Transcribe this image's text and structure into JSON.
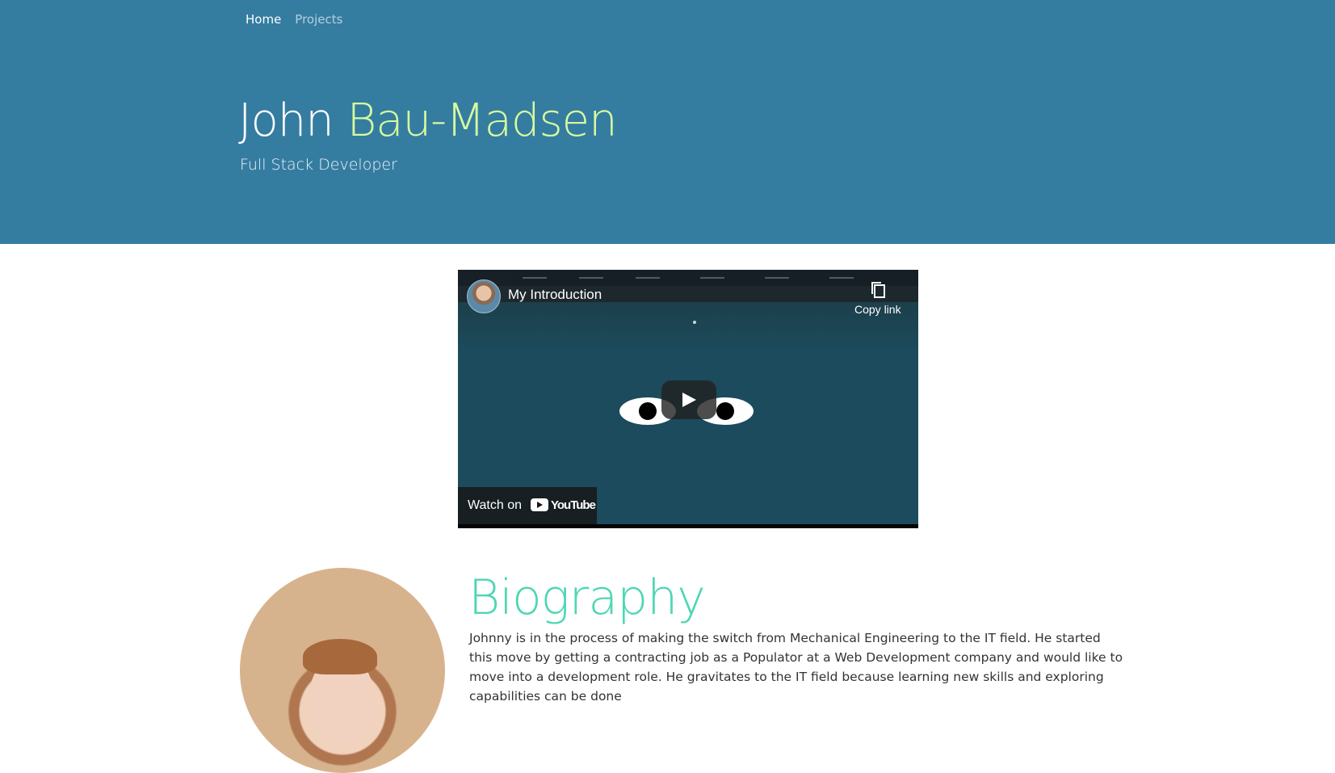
{
  "nav": {
    "home": "Home",
    "projects": "Projects"
  },
  "header": {
    "first_name": "John",
    "last_name": "Bau-Madsen",
    "subtitle": "Full Stack Developer"
  },
  "video": {
    "title": "My Introduction",
    "copy_link": "Copy link",
    "watch_on": "Watch on",
    "brand": "YouTube"
  },
  "biography": {
    "heading": "Biography",
    "text": "Johnny is in the process of making the switch from Mechanical Engineering to the IT field. He started this move by getting a contracting job as a Populator at a Web Development company and would like to move into a development role. He gravitates to the IT field because learning new skills and exploring capabilities can be done"
  },
  "colors": {
    "hero_bg": "#357ca1",
    "last_name": "#d7fb9e",
    "heading_accent": "#4fd6b4"
  }
}
